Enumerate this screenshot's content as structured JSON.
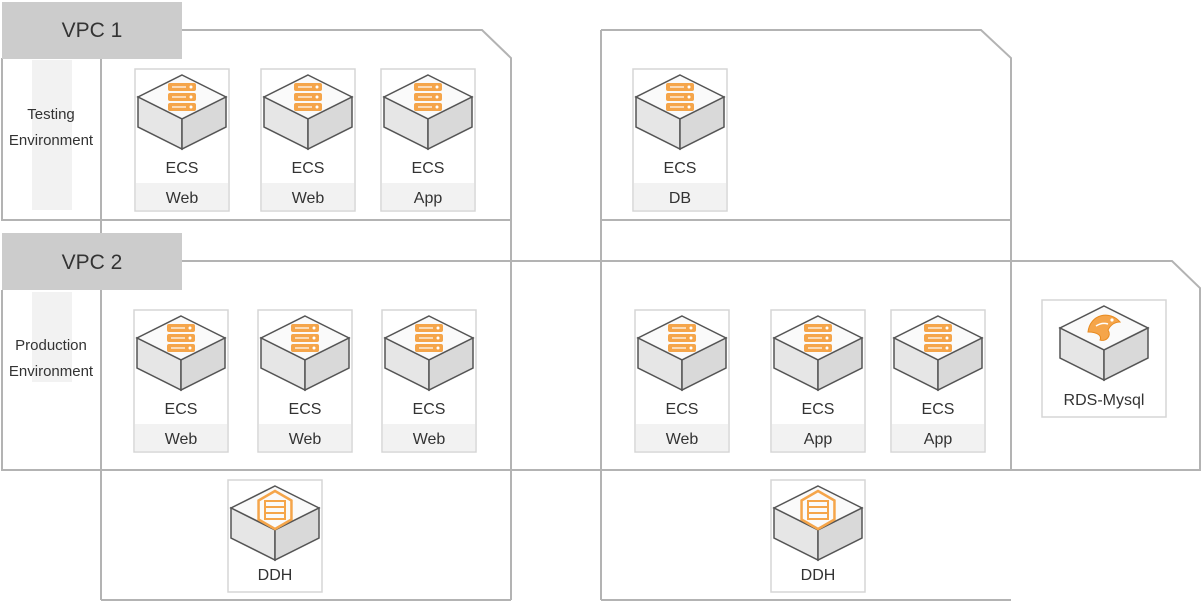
{
  "vpcs": [
    {
      "name": "VPC 1",
      "environment": [
        "Testing",
        "Environment"
      ]
    },
    {
      "name": "VPC 2",
      "environment": [
        "Production",
        "Environment"
      ]
    }
  ],
  "nodes": [
    {
      "id": "t-web-1",
      "type": "ECS",
      "role": "Web",
      "icon": "ecs-server-icon"
    },
    {
      "id": "t-web-2",
      "type": "ECS",
      "role": "Web",
      "icon": "ecs-server-icon"
    },
    {
      "id": "t-app-1",
      "type": "ECS",
      "role": "App",
      "icon": "ecs-server-icon"
    },
    {
      "id": "t-db-1",
      "type": "ECS",
      "role": "DB",
      "icon": "ecs-server-icon"
    },
    {
      "id": "p-web-1",
      "type": "ECS",
      "role": "Web",
      "icon": "ecs-server-icon"
    },
    {
      "id": "p-web-2",
      "type": "ECS",
      "role": "Web",
      "icon": "ecs-server-icon"
    },
    {
      "id": "p-web-3",
      "type": "ECS",
      "role": "Web",
      "icon": "ecs-server-icon"
    },
    {
      "id": "p-web-4",
      "type": "ECS",
      "role": "Web",
      "icon": "ecs-server-icon"
    },
    {
      "id": "p-app-1",
      "type": "ECS",
      "role": "App",
      "icon": "ecs-server-icon"
    },
    {
      "id": "p-app-2",
      "type": "ECS",
      "role": "App",
      "icon": "ecs-server-icon"
    },
    {
      "id": "rds",
      "type": "RDS-Mysql",
      "role": "",
      "icon": "rds-mysql-dolphin-icon"
    },
    {
      "id": "ddh-1",
      "type": "DDH",
      "role": "",
      "icon": "ddh-host-icon"
    },
    {
      "id": "ddh-2",
      "type": "DDH",
      "role": "",
      "icon": "ddh-host-icon"
    }
  ],
  "colors": {
    "accent": "#f5a54a",
    "accent_dark": "#e88a1f",
    "line": "#b3b3b3",
    "label_bg": "#cccccc",
    "text": "#333333"
  }
}
